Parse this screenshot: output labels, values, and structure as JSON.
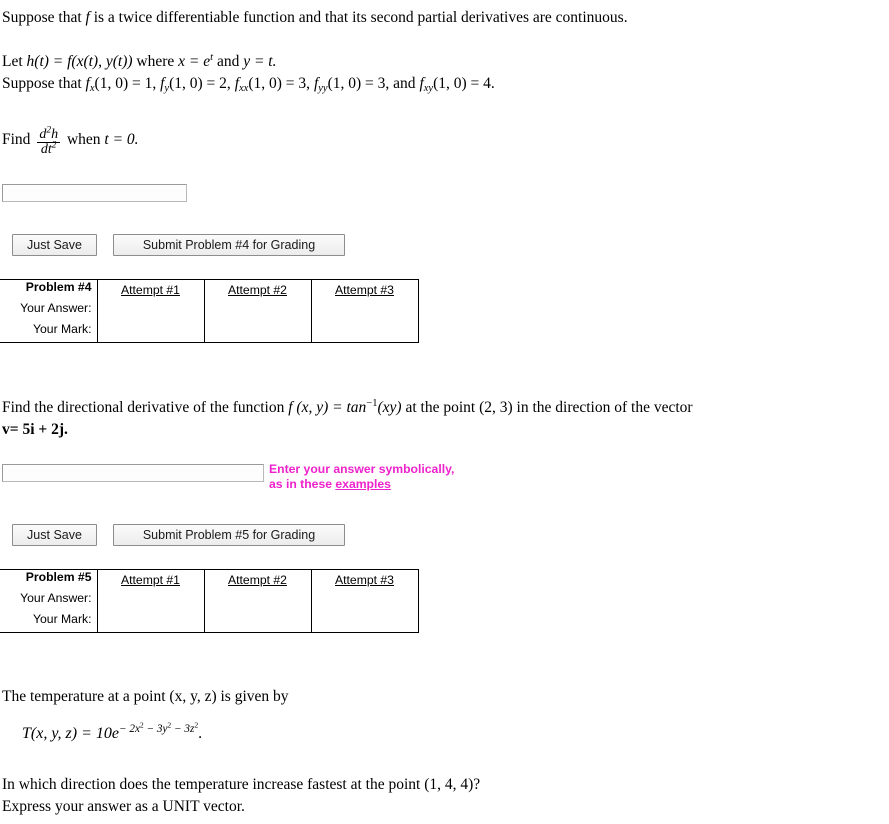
{
  "problem4": {
    "intro": "Suppose that",
    "f_symbol": "f",
    "intro_rest": "is a twice differentiable function and that its second partial derivatives are continuous.",
    "let_prefix": "Let",
    "let_body": "h(t) = f(x(t), y(t))",
    "let_where": "where",
    "let_x": "x = e",
    "let_x_exp": "t",
    "let_and": "and",
    "let_y": "y = t.",
    "suppose_prefix": "Suppose that",
    "given_values": [
      {
        "fn": "f",
        "sub": "x",
        "args": "(1, 0) = 1,"
      },
      {
        "fn": "f",
        "sub": "y",
        "args": "(1, 0) = 2,"
      },
      {
        "fn": "f",
        "sub": "xx",
        "args": "(1, 0) = 3,"
      },
      {
        "fn": "f",
        "sub": "yy",
        "args": "(1, 0) = 3,  and"
      },
      {
        "fn": "f",
        "sub": "xy",
        "args": "(1, 0) = 4."
      }
    ],
    "find_prefix": "Find",
    "frac_num": "d",
    "frac_num_exp": "2",
    "frac_num_var": "h",
    "frac_den": "dt",
    "frac_den_exp": "2",
    "find_suffix_when": "when",
    "find_suffix_t": "t = 0.",
    "answer_value": "",
    "answer_placeholder": "",
    "just_save_label": "Just Save",
    "submit_label": "Submit Problem #4 for Grading",
    "table": {
      "problem_label": "Problem #4",
      "row_labels": [
        "Your Answer:",
        "Your Mark:"
      ],
      "attempt_headers": [
        "Attempt #1",
        "Attempt #2",
        "Attempt #3"
      ],
      "attempt_answers": [
        "",
        "",
        ""
      ],
      "attempt_marks": [
        "",
        "",
        ""
      ]
    }
  },
  "problem5": {
    "line1_a": "Find the directional derivative of the function",
    "line1_f": "f (x, y) = tan",
    "line1_f_exp": "−1",
    "line1_f_arg": "(xy)",
    "line1_b": "at the point (2, 3) in the direction of the vector",
    "line2_v": "v",
    "line2_rest": "= 5i + 2j.",
    "answer_value": "",
    "answer_placeholder": "",
    "hint_line1": "Enter your answer symbolically,",
    "hint_line2_prefix": "as in these",
    "hint_link": "examples",
    "hint_color": "#ee22cc",
    "just_save_label": "Just Save",
    "submit_label": "Submit Problem #5 for Grading",
    "table": {
      "problem_label": "Problem #5",
      "row_labels": [
        "Your Answer:",
        "Your Mark:"
      ],
      "attempt_headers": [
        "Attempt #1",
        "Attempt #2",
        "Attempt #3"
      ],
      "attempt_answers": [
        "",
        "",
        ""
      ],
      "attempt_marks": [
        "",
        "",
        ""
      ]
    }
  },
  "problem6": {
    "line1": "The temperature at a point (x, y, z) is given by",
    "formula_lhs": "T(x, y, z) = 10e",
    "formula_exp": "− 2x",
    "formula_exp_sup1": "2",
    "formula_exp_mid": " − 3y",
    "formula_exp_sup2": "2",
    "formula_exp_mid2": " − 3z",
    "formula_exp_sup3": "2",
    "formula_period": ".",
    "line2": "In which direction does the temperature increase fastest at the point (1, 4, 4)?",
    "line3": "Express your answer as a UNIT vector."
  }
}
